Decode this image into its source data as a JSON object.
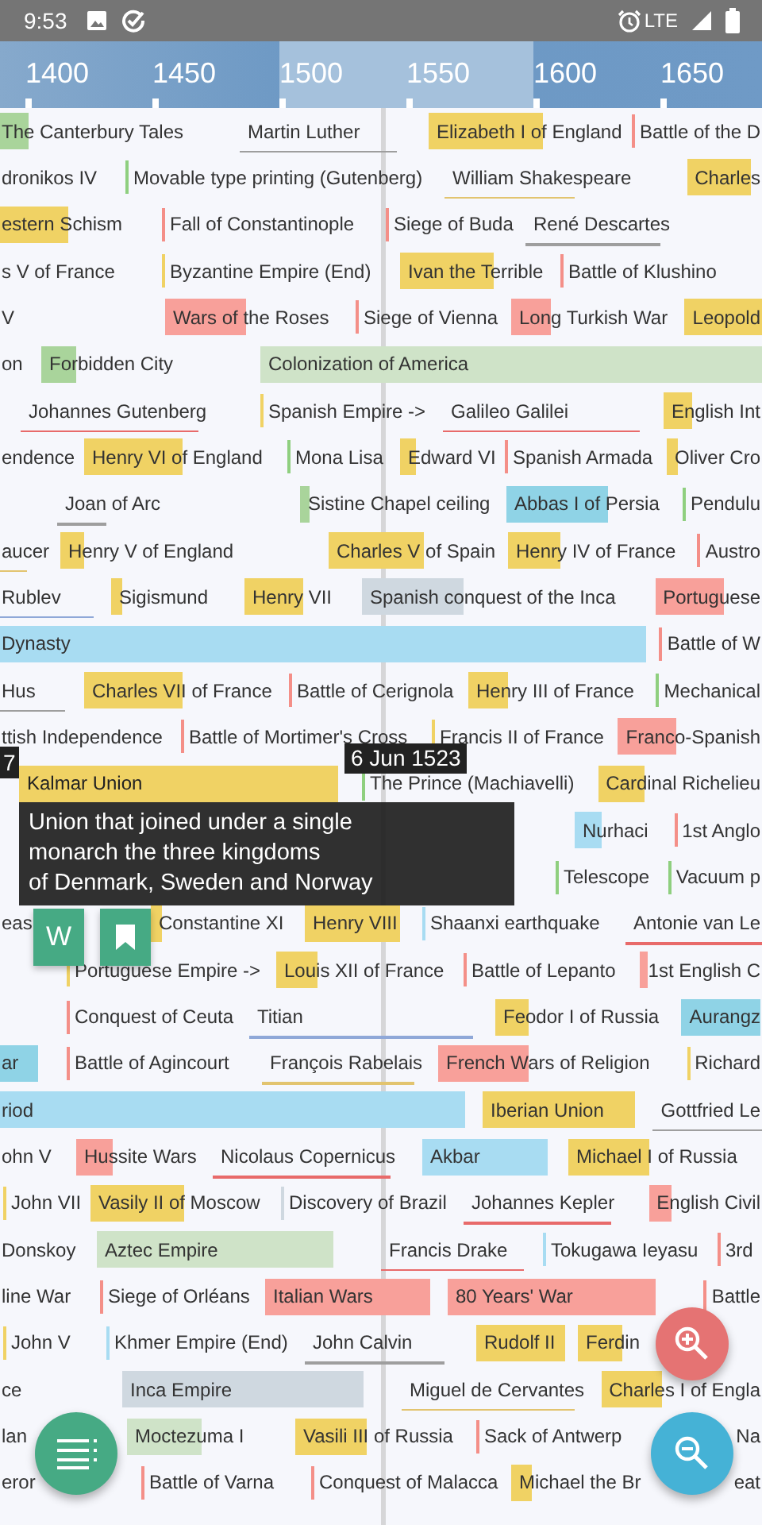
{
  "status_bar": {
    "time": "9:53",
    "network": "LTE"
  },
  "axis": {
    "labels": [
      "1400",
      "1450",
      "1500",
      "1550",
      "1600",
      "1650"
    ]
  },
  "rows": [
    {
      "items": [
        {
          "text": "The Canterbury Tales",
          "kind": "bar",
          "color": "#a9d49b"
        },
        {
          "text": "Martin Luther",
          "kind": "underline",
          "color": "#9e9e9e"
        },
        {
          "text": "Elizabeth I of England",
          "kind": "bar",
          "color": "#f0d264"
        },
        {
          "text": "Battle of the D",
          "kind": "tick",
          "color": "#f48f88"
        }
      ]
    },
    {
      "items": [
        {
          "text": "dronikos IV",
          "kind": "plain"
        },
        {
          "text": "Movable type printing (Gutenberg)",
          "kind": "tick",
          "color": "#8fcf7f"
        },
        {
          "text": "William Shakespeare",
          "kind": "underline",
          "color": "#e2c46f"
        },
        {
          "text": "Charles",
          "kind": "bar",
          "color": "#f0d264"
        }
      ]
    },
    {
      "items": [
        {
          "text": "estern Schism",
          "kind": "bar",
          "color": "#f0d264"
        },
        {
          "text": "Fall of Constantinople",
          "kind": "tick",
          "color": "#f48f88"
        },
        {
          "text": "Siege of Buda",
          "kind": "tick",
          "color": "#f48f88"
        },
        {
          "text": "René Descartes",
          "kind": "underline",
          "color": "#9e9e9e"
        }
      ]
    },
    {
      "items": [
        {
          "text": "s V of France",
          "kind": "plain"
        },
        {
          "text": "Byzantine Empire (End)",
          "kind": "tick",
          "color": "#f0d264"
        },
        {
          "text": "Ivan the Terrible",
          "kind": "bar",
          "color": "#f0d264"
        },
        {
          "text": "Battle of Klushino",
          "kind": "tick",
          "color": "#f48f88"
        }
      ]
    },
    {
      "items": [
        {
          "text": "V",
          "kind": "plain"
        },
        {
          "text": "Wars of the Roses",
          "kind": "bar",
          "color": "#f8a09a"
        },
        {
          "text": "Siege of Vienna",
          "kind": "tick",
          "color": "#f48f88"
        },
        {
          "text": "Long Turkish War",
          "kind": "bar",
          "color": "#f8a09a"
        },
        {
          "text": "Leopold",
          "kind": "bar",
          "color": "#f0d264"
        }
      ]
    },
    {
      "items": [
        {
          "text": "on",
          "kind": "plain"
        },
        {
          "text": "Forbidden City",
          "kind": "bar",
          "color": "#a9d49b"
        },
        {
          "text": "Colonization of America",
          "kind": "bar",
          "color": "#cfe3c8"
        }
      ]
    },
    {
      "items": [
        {
          "text": "Johannes Gutenberg",
          "kind": "underline",
          "color": "#e86a6a"
        },
        {
          "text": "Spanish Empire ->",
          "kind": "tick",
          "color": "#f0d264"
        },
        {
          "text": "Galileo Galilei",
          "kind": "underline",
          "color": "#e86a6a"
        },
        {
          "text": "English Int",
          "kind": "bar",
          "color": "#f0d264"
        }
      ]
    },
    {
      "items": [
        {
          "text": "endence",
          "kind": "plain"
        },
        {
          "text": "Henry VI of England",
          "kind": "bar",
          "color": "#f0d264"
        },
        {
          "text": "Mona Lisa",
          "kind": "tick",
          "color": "#8fcf7f"
        },
        {
          "text": "Edward VI",
          "kind": "bar",
          "color": "#f0d264"
        },
        {
          "text": "Spanish Armada",
          "kind": "tick",
          "color": "#f48f88"
        },
        {
          "text": "Oliver Cro",
          "kind": "bar",
          "color": "#f0d264"
        }
      ]
    },
    {
      "items": [
        {
          "text": "Joan of Arc",
          "kind": "underline",
          "color": "#9e9e9e"
        },
        {
          "text": "Sistine Chapel ceiling",
          "kind": "bar",
          "color": "#a9d49b"
        },
        {
          "text": "Abbas I of Persia",
          "kind": "bar",
          "color": "#8fd3e6"
        },
        {
          "text": "Pendulu",
          "kind": "tick",
          "color": "#8fcf7f"
        }
      ]
    },
    {
      "items": [
        {
          "text": "aucer",
          "kind": "underline",
          "color": "#e2c46f"
        },
        {
          "text": "Henry V of England",
          "kind": "bar",
          "color": "#f0d264"
        },
        {
          "text": "Charles V of Spain",
          "kind": "bar",
          "color": "#f0d264"
        },
        {
          "text": "Henry IV of France",
          "kind": "bar",
          "color": "#f0d264"
        },
        {
          "text": "Austro",
          "kind": "tick",
          "color": "#f48f88"
        }
      ]
    },
    {
      "items": [
        {
          "text": "Rublev",
          "kind": "underline",
          "color": "#8fa8d8"
        },
        {
          "text": "Sigismund",
          "kind": "bar",
          "color": "#f0d264"
        },
        {
          "text": "Henry VII",
          "kind": "bar",
          "color": "#f0d264"
        },
        {
          "text": "Spanish conquest of the Inca",
          "kind": "bar",
          "color": "#cfd8e0"
        },
        {
          "text": "Portuguese",
          "kind": "bar",
          "color": "#f8a09a"
        }
      ]
    },
    {
      "items": [
        {
          "text": "Dynasty",
          "kind": "bar",
          "color": "#a8dcf2"
        },
        {
          "text": "Battle of W",
          "kind": "tick",
          "color": "#f48f88"
        }
      ]
    },
    {
      "items": [
        {
          "text": "Hus",
          "kind": "underline",
          "color": "#9e9e9e"
        },
        {
          "text": "Charles VII of France",
          "kind": "bar",
          "color": "#f0d264"
        },
        {
          "text": "Battle of Cerignola",
          "kind": "tick",
          "color": "#f48f88"
        },
        {
          "text": "Henry III of France",
          "kind": "bar",
          "color": "#f0d264"
        },
        {
          "text": "Mechanical",
          "kind": "tick",
          "color": "#8fcf7f"
        }
      ]
    },
    {
      "items": [
        {
          "text": "ttish Independence",
          "kind": "plain"
        },
        {
          "text": "Battle of Mortimer's Cross",
          "kind": "tick",
          "color": "#f48f88"
        },
        {
          "text": "Francis II of France",
          "kind": "tick",
          "color": "#f0d264"
        },
        {
          "text": "Franco-Spanish",
          "kind": "bar",
          "color": "#f8a09a"
        }
      ]
    },
    {
      "items": [
        {
          "text": "Kalmar Union",
          "kind": "bar",
          "color": "#f0d264"
        },
        {
          "text": "The Prince (Machiavelli)",
          "kind": "tick",
          "color": "#8fcf7f"
        },
        {
          "text": "Cardinal Richelieu",
          "kind": "bar",
          "color": "#f0d264"
        }
      ]
    },
    {
      "items": [
        {
          "text": "Nurhaci",
          "kind": "bar",
          "color": "#a8dcf2"
        },
        {
          "text": "1st Anglo",
          "kind": "tick",
          "color": "#f48f88"
        }
      ]
    },
    {
      "items": [
        {
          "text": "Telescope",
          "kind": "tick",
          "color": "#8fcf7f"
        },
        {
          "text": "Vacuum p",
          "kind": "tick",
          "color": "#8fcf7f"
        }
      ]
    },
    {
      "items": [
        {
          "text": "eas",
          "kind": "plain"
        },
        {
          "text": "Constantine XI",
          "kind": "bar",
          "color": "#f0d264"
        },
        {
          "text": "Henry VIII",
          "kind": "bar",
          "color": "#f0d264"
        },
        {
          "text": "Shaanxi earthquake",
          "kind": "tick",
          "color": "#a8dcf2"
        },
        {
          "text": "Antonie van Le",
          "kind": "underline",
          "color": "#e86a6a"
        }
      ]
    },
    {
      "items": [
        {
          "text": "Portuguese Empire ->",
          "kind": "tick",
          "color": "#f0d264"
        },
        {
          "text": "Louis XII of France",
          "kind": "bar",
          "color": "#f0d264"
        },
        {
          "text": "Battle of Lepanto",
          "kind": "tick",
          "color": "#f48f88"
        },
        {
          "text": "1st English C",
          "kind": "bar",
          "color": "#f8a09a"
        }
      ]
    },
    {
      "items": [
        {
          "text": "Conquest of Ceuta",
          "kind": "tick",
          "color": "#f48f88"
        },
        {
          "text": "Titian",
          "kind": "underline",
          "color": "#8fa8d8"
        },
        {
          "text": "Feodor I of Russia",
          "kind": "bar",
          "color": "#f0d264"
        },
        {
          "text": "Aurangz",
          "kind": "bar",
          "color": "#8fd3e6"
        }
      ]
    },
    {
      "items": [
        {
          "text": "ar",
          "kind": "bar",
          "color": "#8fd3e6"
        },
        {
          "text": "Battle of Agincourt",
          "kind": "tick",
          "color": "#f48f88"
        },
        {
          "text": "François Rabelais",
          "kind": "underline",
          "color": "#e2c46f"
        },
        {
          "text": "French Wars of Religion",
          "kind": "bar",
          "color": "#f8a09a"
        },
        {
          "text": "Richard",
          "kind": "tick",
          "color": "#f0d264"
        }
      ]
    },
    {
      "items": [
        {
          "text": "riod",
          "kind": "bar",
          "color": "#a8dcf2"
        },
        {
          "text": "Iberian Union",
          "kind": "bar",
          "color": "#f0d264"
        },
        {
          "text": "Gottfried Le",
          "kind": "underline",
          "color": "#9e9e9e"
        }
      ]
    },
    {
      "items": [
        {
          "text": "ohn V",
          "kind": "plain"
        },
        {
          "text": "Hussite Wars",
          "kind": "bar",
          "color": "#f8a09a"
        },
        {
          "text": "Nicolaus Copernicus",
          "kind": "underline",
          "color": "#e86a6a"
        },
        {
          "text": "Akbar",
          "kind": "bar",
          "color": "#a8dcf2"
        },
        {
          "text": "Michael I of Russia",
          "kind": "bar",
          "color": "#f0d264"
        }
      ]
    },
    {
      "items": [
        {
          "text": "John VII",
          "kind": "tick",
          "color": "#f0d264"
        },
        {
          "text": "Vasily II of Moscow",
          "kind": "bar",
          "color": "#f0d264"
        },
        {
          "text": "Discovery of Brazil",
          "kind": "tick",
          "color": "#cfd8e0"
        },
        {
          "text": "Johannes Kepler",
          "kind": "underline",
          "color": "#e86a6a"
        },
        {
          "text": "English Civil",
          "kind": "bar",
          "color": "#f8a09a"
        }
      ]
    },
    {
      "items": [
        {
          "text": "Donskoy",
          "kind": "plain"
        },
        {
          "text": "Aztec Empire",
          "kind": "bar",
          "color": "#cfe3c8"
        },
        {
          "text": "Francis Drake",
          "kind": "underline",
          "color": "#e86a6a"
        },
        {
          "text": "Tokugawa Ieyasu",
          "kind": "tick",
          "color": "#a8dcf2"
        },
        {
          "text": "3rd",
          "kind": "tick",
          "color": "#f48f88"
        }
      ]
    },
    {
      "items": [
        {
          "text": "line War",
          "kind": "plain"
        },
        {
          "text": "Siege of Orléans",
          "kind": "tick",
          "color": "#f48f88"
        },
        {
          "text": "Italian Wars",
          "kind": "bar",
          "color": "#f8a09a"
        },
        {
          "text": "80 Years' War",
          "kind": "bar",
          "color": "#f8a09a"
        },
        {
          "text": "Battle",
          "kind": "tick",
          "color": "#f48f88"
        }
      ]
    },
    {
      "items": [
        {
          "text": "John V",
          "kind": "tick",
          "color": "#f0d264"
        },
        {
          "text": "Khmer Empire (End)",
          "kind": "tick",
          "color": "#a8dcf2"
        },
        {
          "text": "John Calvin",
          "kind": "underline",
          "color": "#9e9e9e"
        },
        {
          "text": "Rudolf II",
          "kind": "bar",
          "color": "#f0d264"
        },
        {
          "text": "Ferdin",
          "kind": "bar",
          "color": "#f0d264"
        }
      ]
    },
    {
      "items": [
        {
          "text": "ce",
          "kind": "plain"
        },
        {
          "text": "Inca Empire",
          "kind": "bar",
          "color": "#cfd8e0"
        },
        {
          "text": "Miguel de Cervantes",
          "kind": "underline",
          "color": "#e2c46f"
        },
        {
          "text": "Charles I of Engla",
          "kind": "bar",
          "color": "#f0d264"
        }
      ]
    },
    {
      "items": [
        {
          "text": "lan",
          "kind": "plain"
        },
        {
          "text": "Moctezuma I",
          "kind": "bar",
          "color": "#cfe3c8"
        },
        {
          "text": "Vasili III of Russia",
          "kind": "bar",
          "color": "#f0d264"
        },
        {
          "text": "Sack of Antwerp",
          "kind": "tick",
          "color": "#f48f88"
        },
        {
          "text": "Na",
          "kind": "plain"
        }
      ]
    },
    {
      "items": [
        {
          "text": "eror",
          "kind": "plain"
        },
        {
          "text": "Battle of Varna",
          "kind": "tick",
          "color": "#f48f88"
        },
        {
          "text": "Conquest of Malacca",
          "kind": "tick",
          "color": "#f48f88"
        },
        {
          "text": "Michael the Br",
          "kind": "bar",
          "color": "#f0d264"
        },
        {
          "text": "eat",
          "kind": "plain"
        }
      ]
    }
  ],
  "edge_date": "7",
  "cursor_date": "6 Jun 1523",
  "tooltip": {
    "text": "Union that joined under a single\nmonarch the three kingdoms\nof Denmark, Sweden and Norway"
  },
  "actions": {
    "wiki": "W"
  }
}
